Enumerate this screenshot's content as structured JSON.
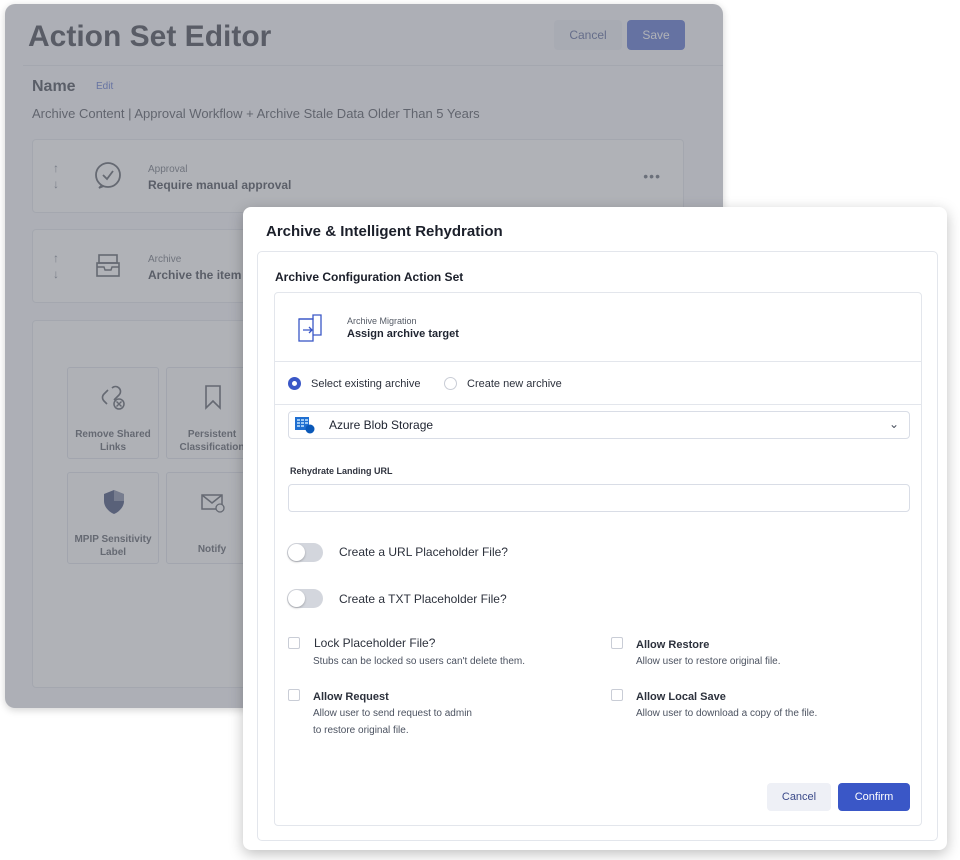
{
  "editor": {
    "title": "Action Set Editor",
    "cancel_label": "Cancel",
    "save_label": "Save",
    "name_label": "Name",
    "edit_label": "Edit",
    "description": "Archive Content | Approval Workflow + Archive Stale Data Older Than 5 Years",
    "cards": [
      {
        "label": "Approval",
        "title": "Require manual approval",
        "icon": "check-circle-icon"
      },
      {
        "label": "Archive",
        "title": "Archive the item",
        "icon": "archive-box-icon"
      }
    ],
    "tiles": [
      {
        "label": "Remove Shared Links",
        "icon": "unlink-icon"
      },
      {
        "label": "Persistent Classification",
        "icon": "bookmark-icon"
      },
      {
        "label": "MPIP Sensitivity Label",
        "icon": "shield-icon"
      },
      {
        "label": "Notify",
        "icon": "mail-icon"
      }
    ]
  },
  "modal": {
    "title": "Archive & Intelligent Rehydration",
    "subtitle": "Archive Configuration Action Set",
    "migration": {
      "label": "Archive Migration",
      "title": "Assign archive target"
    },
    "radios": {
      "existing": "Select existing archive",
      "new": "Create new archive",
      "selected": "existing"
    },
    "storage": {
      "selected": "Azure Blob Storage"
    },
    "rehydrate": {
      "label": "Rehydrate Landing URL",
      "value": "",
      "placeholder": ""
    },
    "toggles": {
      "url_placeholder": "Create a URL Placeholder File?",
      "txt_placeholder": "Create a TXT Placeholder File?"
    },
    "checks": {
      "lock": {
        "title": "Lock Placeholder File?",
        "desc": "Stubs can be locked so users can't delete them."
      },
      "restore": {
        "title": "Allow Restore",
        "desc": "Allow user to restore original file."
      },
      "request": {
        "title": "Allow Request",
        "desc1": "Allow user to send request to admin",
        "desc2": "to restore original file."
      },
      "local_save": {
        "title": "Allow Local Save",
        "desc": "Allow user to download a copy of the file."
      }
    },
    "cancel_label": "Cancel",
    "confirm_label": "Confirm"
  },
  "colors": {
    "accent": "#3a57c7",
    "overlay": "#80828a"
  }
}
